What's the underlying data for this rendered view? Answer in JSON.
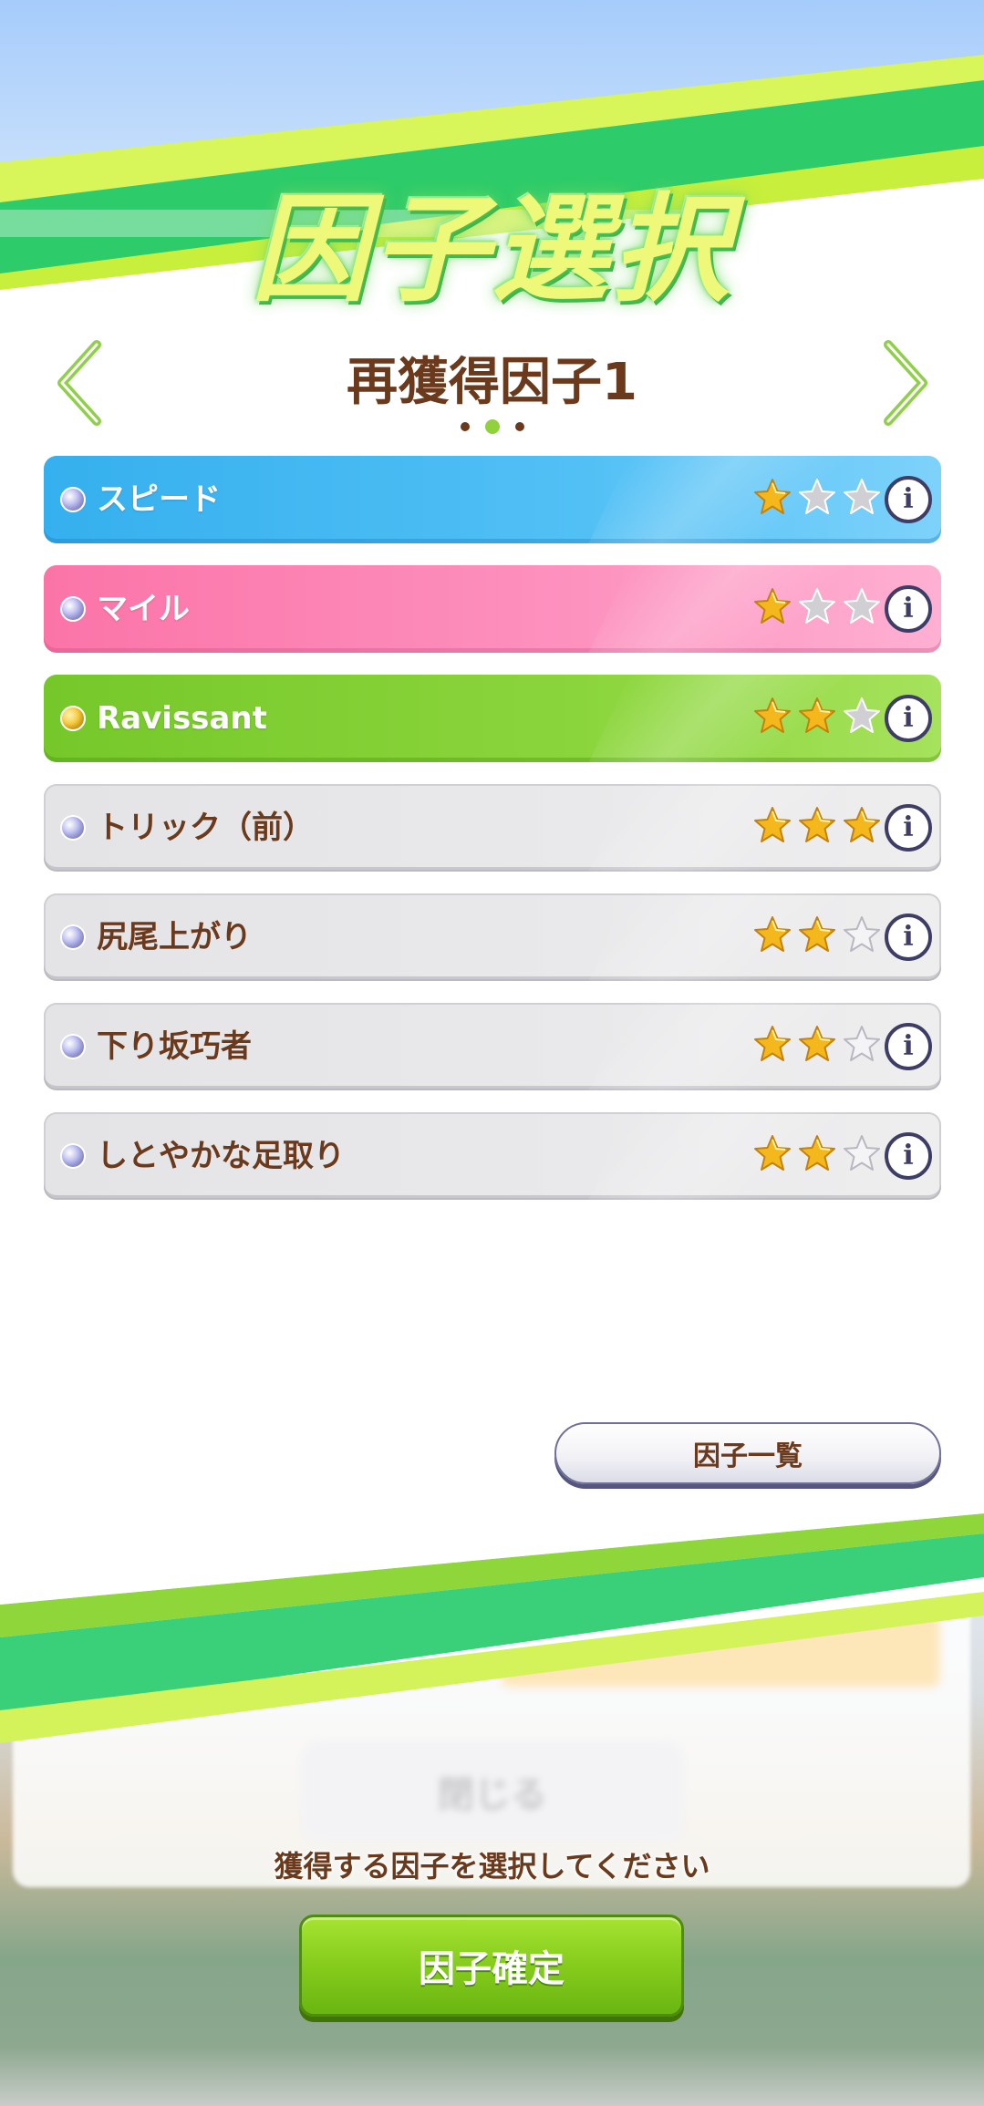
{
  "screen": {
    "title": "因子選択",
    "page_title": "再獲得因子1",
    "page_count": 3,
    "current_page": 2
  },
  "factors": [
    {
      "name": "スピード",
      "color": "blue",
      "bullet": "blue",
      "stars": 1,
      "max_stars": 3
    },
    {
      "name": "マイル",
      "color": "pink",
      "bullet": "blue",
      "stars": 1,
      "max_stars": 3
    },
    {
      "name": "Ravissant",
      "color": "green",
      "bullet": "gold",
      "stars": 2,
      "max_stars": 3
    },
    {
      "name": "トリック（前）",
      "color": "white",
      "bullet": "blue",
      "stars": 3,
      "max_stars": 3
    },
    {
      "name": "尻尾上がり",
      "color": "white",
      "bullet": "blue",
      "stars": 2,
      "max_stars": 3
    },
    {
      "name": "下り坂巧者",
      "color": "white",
      "bullet": "blue",
      "stars": 2,
      "max_stars": 3
    },
    {
      "name": "しとやかな足取り",
      "color": "white",
      "bullet": "blue",
      "stars": 2,
      "max_stars": 3
    }
  ],
  "info_label": "i",
  "factor_list_button": "因子一覧",
  "background_close_label": "閉じる",
  "instruction": "獲得する因子を選択してください",
  "confirm_button": "因子確定",
  "colors": {
    "text_brown": "#6b3a1c",
    "speed_blue": "#35b0ee",
    "mile_pink": "#fb74a8",
    "unique_green": "#76c82a",
    "confirm_green": "#86cc1c",
    "star_gold": "#f5b81c"
  }
}
